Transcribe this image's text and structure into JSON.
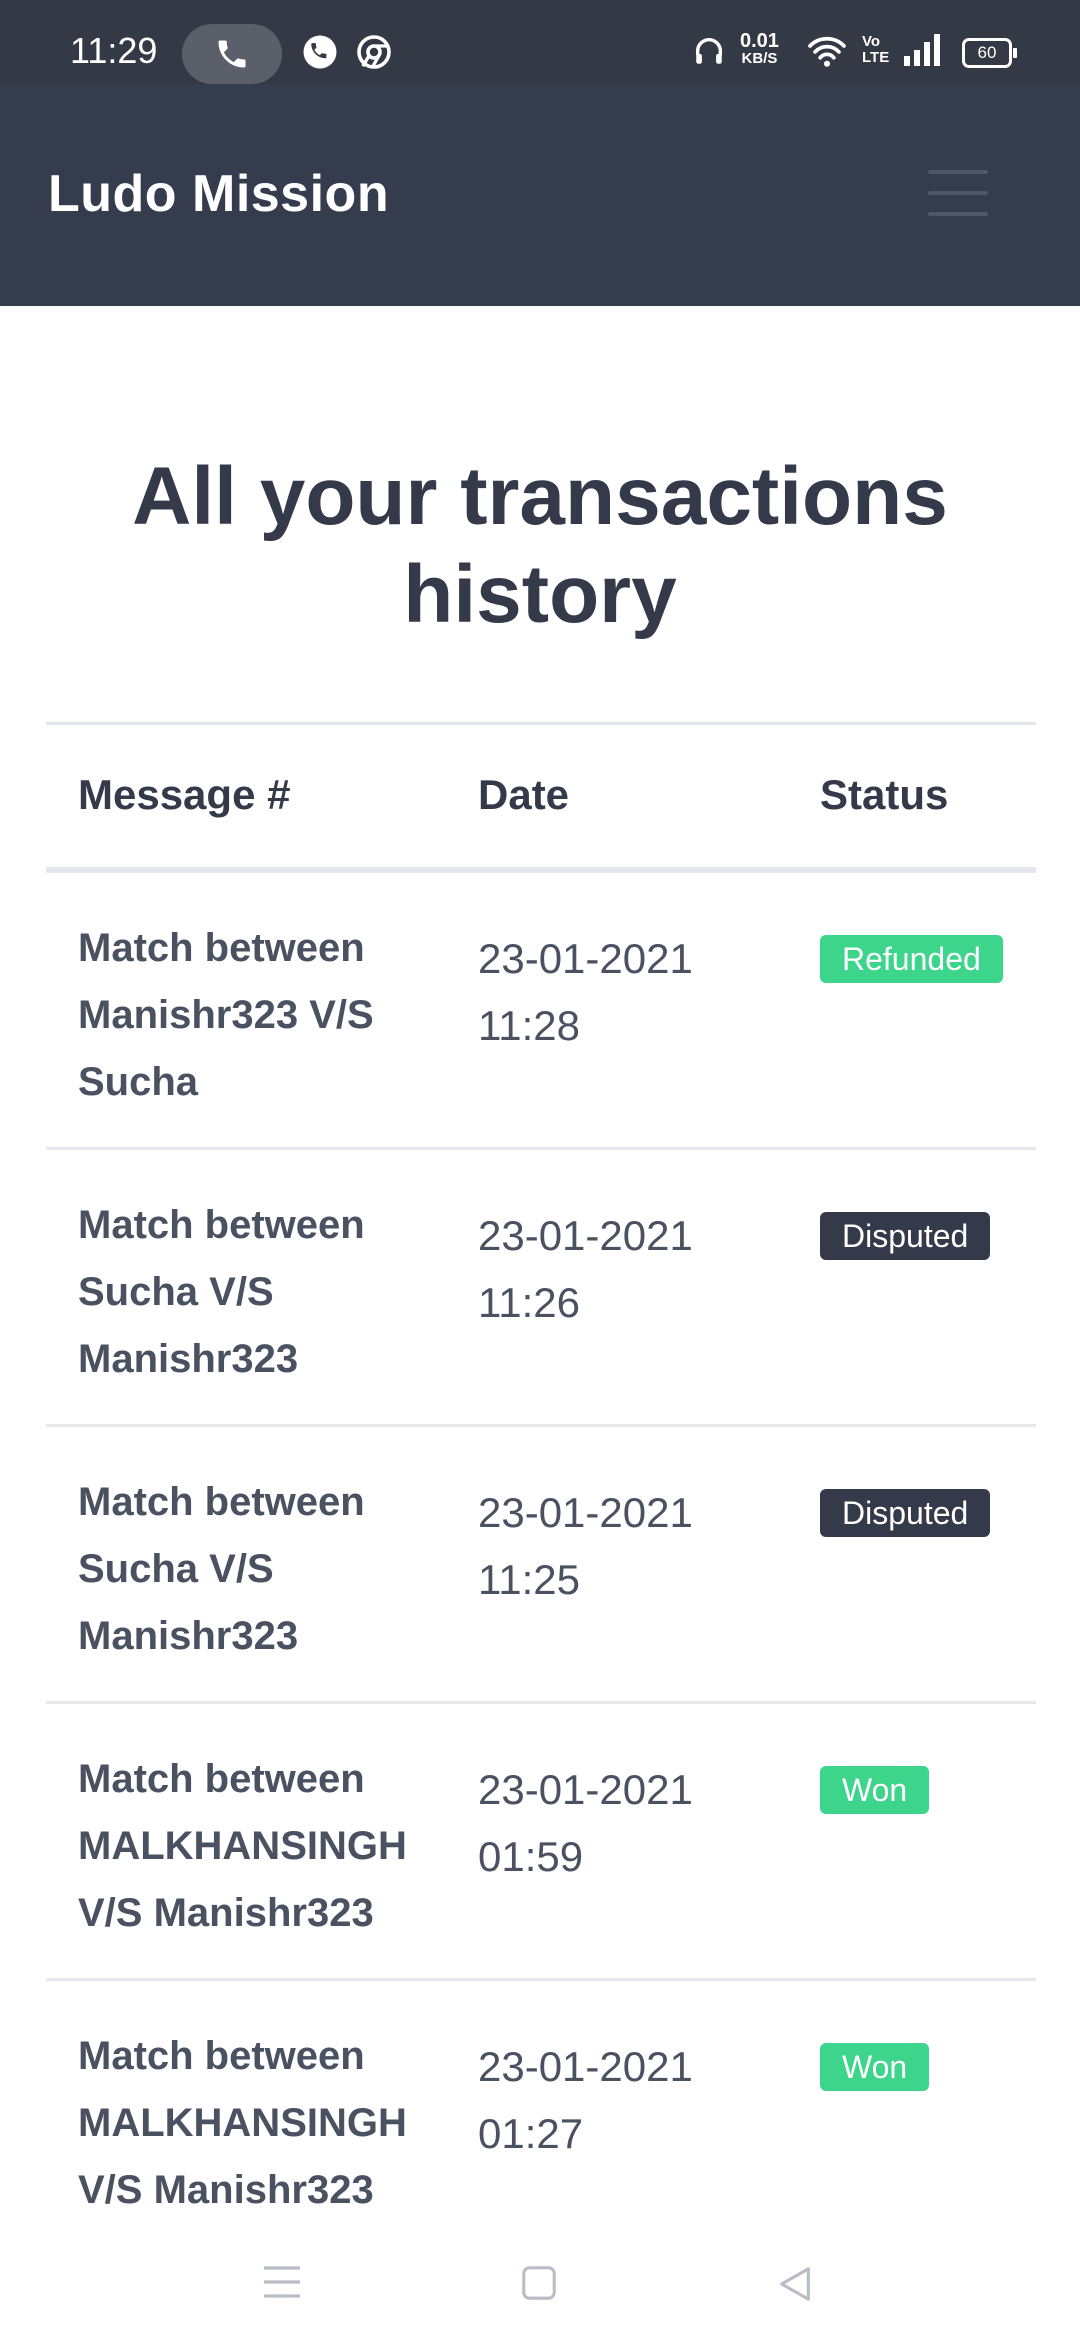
{
  "status_bar": {
    "time": "11:29",
    "net_speed": "0.01",
    "net_unit": "KB/S",
    "lte_top": "Vo",
    "lte_bottom": "LTE",
    "battery": "60"
  },
  "header": {
    "brand": "Ludo Mission"
  },
  "title": "All your transactions history",
  "table": {
    "columns": [
      "Message #",
      "Date",
      "Status"
    ],
    "rows": [
      {
        "message": "Match between Manishr323 V/S Sucha",
        "date": "23-01-2021 11:28",
        "status": "Refunded",
        "status_color": "#3dd48c"
      },
      {
        "message": "Match between Sucha V/S Manishr323",
        "date": "23-01-2021 11:26",
        "status": "Disputed",
        "status_color": "#343a4a"
      },
      {
        "message": "Match between Sucha V/S Manishr323",
        "date": "23-01-2021 11:25",
        "status": "Disputed",
        "status_color": "#343a4a"
      },
      {
        "message": "Match between MALKHANSINGH V/S Manishr323",
        "date": "23-01-2021 01:59",
        "status": "Won",
        "status_color": "#3dd48c"
      },
      {
        "message": "Match between MALKHANSINGH V/S Manishr323",
        "date": "23-01-2021 01:27",
        "status": "Won",
        "status_color": "#3dd48c"
      }
    ]
  },
  "colors": {
    "header_bg": "#353c4d",
    "status_green": "#3dd48c",
    "status_dark": "#343a4a"
  }
}
